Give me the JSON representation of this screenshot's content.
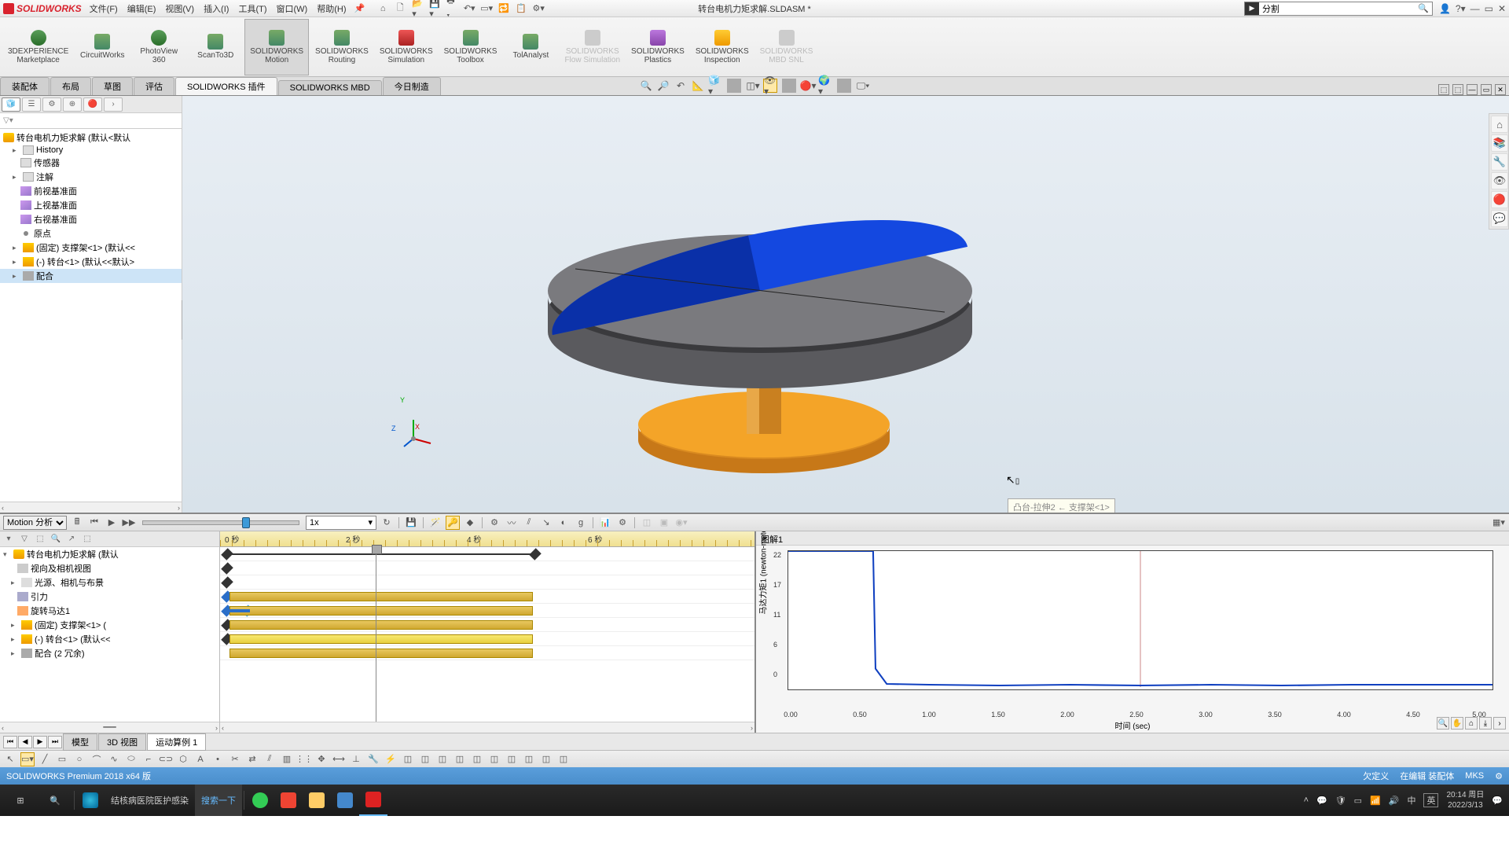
{
  "title_bar": {
    "logo": "SOLIDWORKS",
    "menu": [
      "文件(F)",
      "编辑(E)",
      "视图(V)",
      "插入(I)",
      "工具(T)",
      "窗口(W)",
      "帮助(H)"
    ],
    "doc_title": "转台电机力矩求解.SLDASM *",
    "search_text": "分割"
  },
  "ribbon": [
    {
      "label1": "3DEXPERIENCE",
      "label2": "Marketplace"
    },
    {
      "label1": "CircuitWorks",
      "label2": ""
    },
    {
      "label1": "PhotoView",
      "label2": "360"
    },
    {
      "label1": "ScanTo3D",
      "label2": ""
    },
    {
      "label1": "SOLIDWORKS",
      "label2": "Motion"
    },
    {
      "label1": "SOLIDWORKS",
      "label2": "Routing"
    },
    {
      "label1": "SOLIDWORKS",
      "label2": "Simulation"
    },
    {
      "label1": "SOLIDWORKS",
      "label2": "Toolbox"
    },
    {
      "label1": "TolAnalyst",
      "label2": ""
    },
    {
      "label1": "SOLIDWORKS",
      "label2": "Flow Simulation"
    },
    {
      "label1": "SOLIDWORKS",
      "label2": "Plastics"
    },
    {
      "label1": "SOLIDWORKS",
      "label2": "Inspection"
    },
    {
      "label1": "SOLIDWORKS",
      "label2": "MBD SNL"
    }
  ],
  "tabs": [
    "装配体",
    "布局",
    "草图",
    "评估",
    "SOLIDWORKS 插件",
    "SOLIDWORKS MBD",
    "今日制造"
  ],
  "tree": {
    "root": "转台电机力矩求解  (默认<默认",
    "items": [
      "History",
      "传感器",
      "注解",
      "前视基准面",
      "上视基准面",
      "右视基准面",
      "原点",
      "(固定) 支撑架<1> (默认<<",
      "(-) 转台<1> (默认<<默认>",
      "配合"
    ]
  },
  "viewport": {
    "tooltip": "凸台-拉伸2 ← 支撑架<1>"
  },
  "motion": {
    "study_type": "Motion 分析",
    "speed": "1x",
    "ruler": [
      "0 秒",
      "2 秒",
      "4 秒",
      "6 秒"
    ],
    "tree": [
      "转台电机力矩求解  (默认",
      "视向及相机视图",
      "光源、相机与布景",
      "引力",
      "旋转马达1",
      "(固定) 支撑架<1> (",
      "(-) 转台<1> (默认<<",
      "配合 (2 冗余)"
    ]
  },
  "chart_data": {
    "type": "line",
    "title": "图解1",
    "xlabel": "时间 (sec)",
    "ylabel": "马达力矩1 (newton-meter)",
    "xlim": [
      0,
      5.0
    ],
    "ylim": [
      0,
      22
    ],
    "yticks": [
      0,
      6,
      11,
      17,
      22
    ],
    "xticks": [
      0.0,
      0.5,
      1.0,
      1.5,
      2.0,
      2.5,
      3.0,
      3.5,
      4.0,
      4.5,
      5.0
    ],
    "x": [
      0.0,
      0.6,
      0.62,
      0.7,
      1.0,
      1.5,
      2.0,
      2.5,
      3.0,
      3.5,
      4.0,
      4.5,
      5.0
    ],
    "y": [
      22,
      22,
      3,
      0.5,
      0.3,
      0.2,
      0.3,
      0.2,
      0.3,
      0.2,
      0.3,
      0.3,
      0.3
    ],
    "marker_x": 2.5
  },
  "bottom_tabs": [
    "模型",
    "3D 视图",
    "运动算例 1"
  ],
  "status": {
    "left": "SOLIDWORKS Premium 2018 x64 版",
    "right": [
      "欠定义",
      "在编辑 装配体",
      "MKS",
      "▾"
    ]
  },
  "taskbar": {
    "news": "结核病医院医护感染",
    "search_btn": "搜索一下",
    "ime": "中",
    "kb": "英",
    "clock_time": "20:14 周日",
    "clock_date": "2022/3/13"
  }
}
